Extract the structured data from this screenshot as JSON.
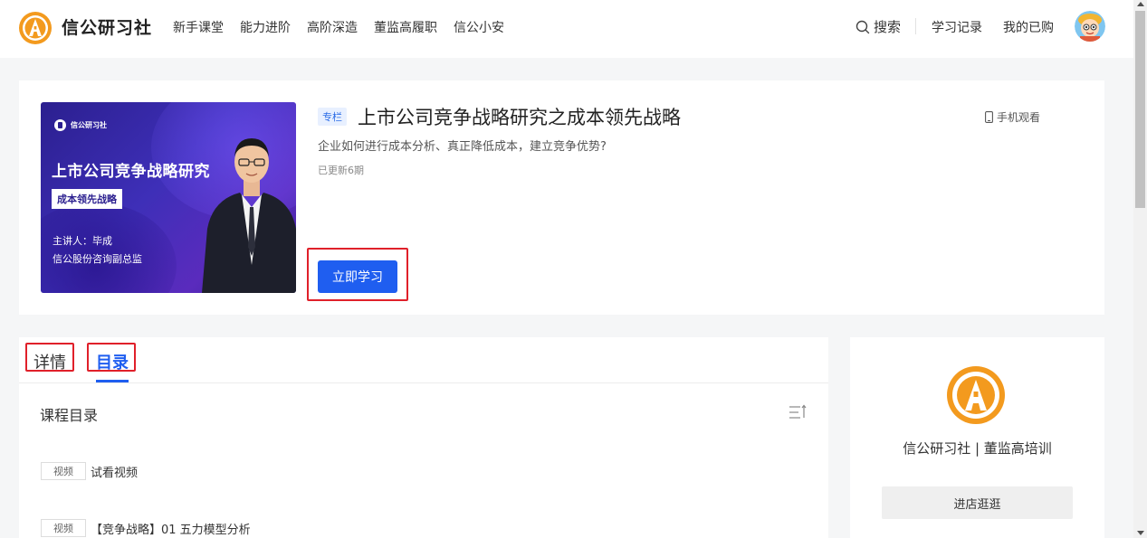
{
  "header": {
    "brand": "信公研习社",
    "nav": [
      {
        "label": "新手课堂"
      },
      {
        "label": "能力进阶"
      },
      {
        "label": "高阶深造"
      },
      {
        "label": "董监高履职"
      },
      {
        "label": "信公小安"
      }
    ],
    "search_label": "搜索",
    "history_label": "学习记录",
    "purchased_label": "我的已购"
  },
  "course": {
    "badge": "专栏",
    "title": "上市公司竞争战略研究之成本领先战略",
    "subtitle": "企业如何进行成本分析、真正降低成本，建立竞争优势?",
    "updates": "已更新6期",
    "mobile_watch": "手机观看",
    "study_button": "立即学习",
    "cover": {
      "brand": "信公研习社",
      "title": "上市公司竞争战略研究",
      "tag": "成本领先战略",
      "line1": "主讲人：毕成",
      "line2": "信公股份咨询副总监"
    }
  },
  "catalog": {
    "tabs": [
      {
        "label": "详情",
        "active": false
      },
      {
        "label": "目录",
        "active": true
      }
    ],
    "section_title": "课程目录",
    "lessons": [
      {
        "type": "视频",
        "name": "试看视频"
      },
      {
        "type": "视频",
        "name": "【竞争战略】01 五力模型分析"
      }
    ]
  },
  "shop": {
    "name": "信公研习社 | 董监高培训",
    "button": "进店逛逛"
  },
  "colors": {
    "accent": "#1f5ef0",
    "highlight_box": "#e0202a",
    "logo_orange": "#f39a1e"
  },
  "icons": [
    "logo-icon",
    "search-icon",
    "avatar",
    "mobile-icon",
    "sort-icon",
    "shop-logo-icon"
  ]
}
